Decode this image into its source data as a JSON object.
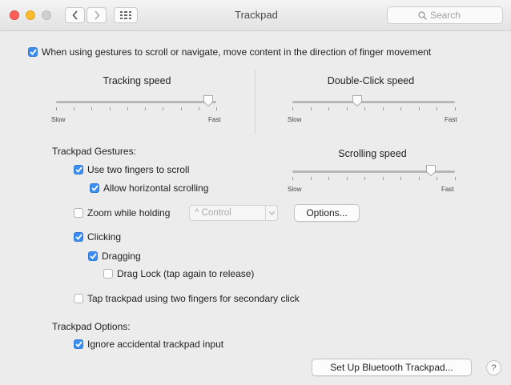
{
  "window": {
    "title": "Trackpad",
    "search_placeholder": "Search"
  },
  "natural_scroll": {
    "label": "When using gestures to scroll or navigate, move content in the direction of finger movement",
    "checked": true
  },
  "tracking_speed": {
    "title": "Tracking speed",
    "min_label": "Slow",
    "max_label": "Fast",
    "value": 0.95
  },
  "double_click_speed": {
    "title": "Double-Click speed",
    "min_label": "Slow",
    "max_label": "Fast",
    "value": 0.4
  },
  "scrolling_speed": {
    "title": "Scrolling speed",
    "min_label": "Slow",
    "max_label": "Fast",
    "value": 0.85
  },
  "gestures": {
    "header": "Trackpad Gestures:",
    "two_finger_scroll": {
      "label": "Use two fingers to scroll",
      "checked": true
    },
    "horizontal_scroll": {
      "label": "Allow horizontal scrolling",
      "checked": true
    },
    "zoom_holding": {
      "label": "Zoom while holding",
      "checked": false,
      "modifier": "^ Control",
      "options_label": "Options..."
    },
    "clicking": {
      "label": "Clicking",
      "checked": true
    },
    "dragging": {
      "label": "Dragging",
      "checked": true
    },
    "drag_lock": {
      "label": "Drag Lock (tap again to release)",
      "checked": false
    },
    "secondary_click": {
      "label": "Tap trackpad using two fingers for secondary click",
      "checked": false
    }
  },
  "options": {
    "header": "Trackpad Options:",
    "ignore_accidental": {
      "label": "Ignore accidental trackpad input",
      "checked": true
    }
  },
  "bluetooth_button": "Set Up Bluetooth Trackpad...",
  "help_label": "?",
  "colors": {
    "accent": "#3b8ef0",
    "close": "#fc5f57",
    "minimize": "#fdbc2e",
    "zoom_disabled": "#cfcfcf"
  }
}
